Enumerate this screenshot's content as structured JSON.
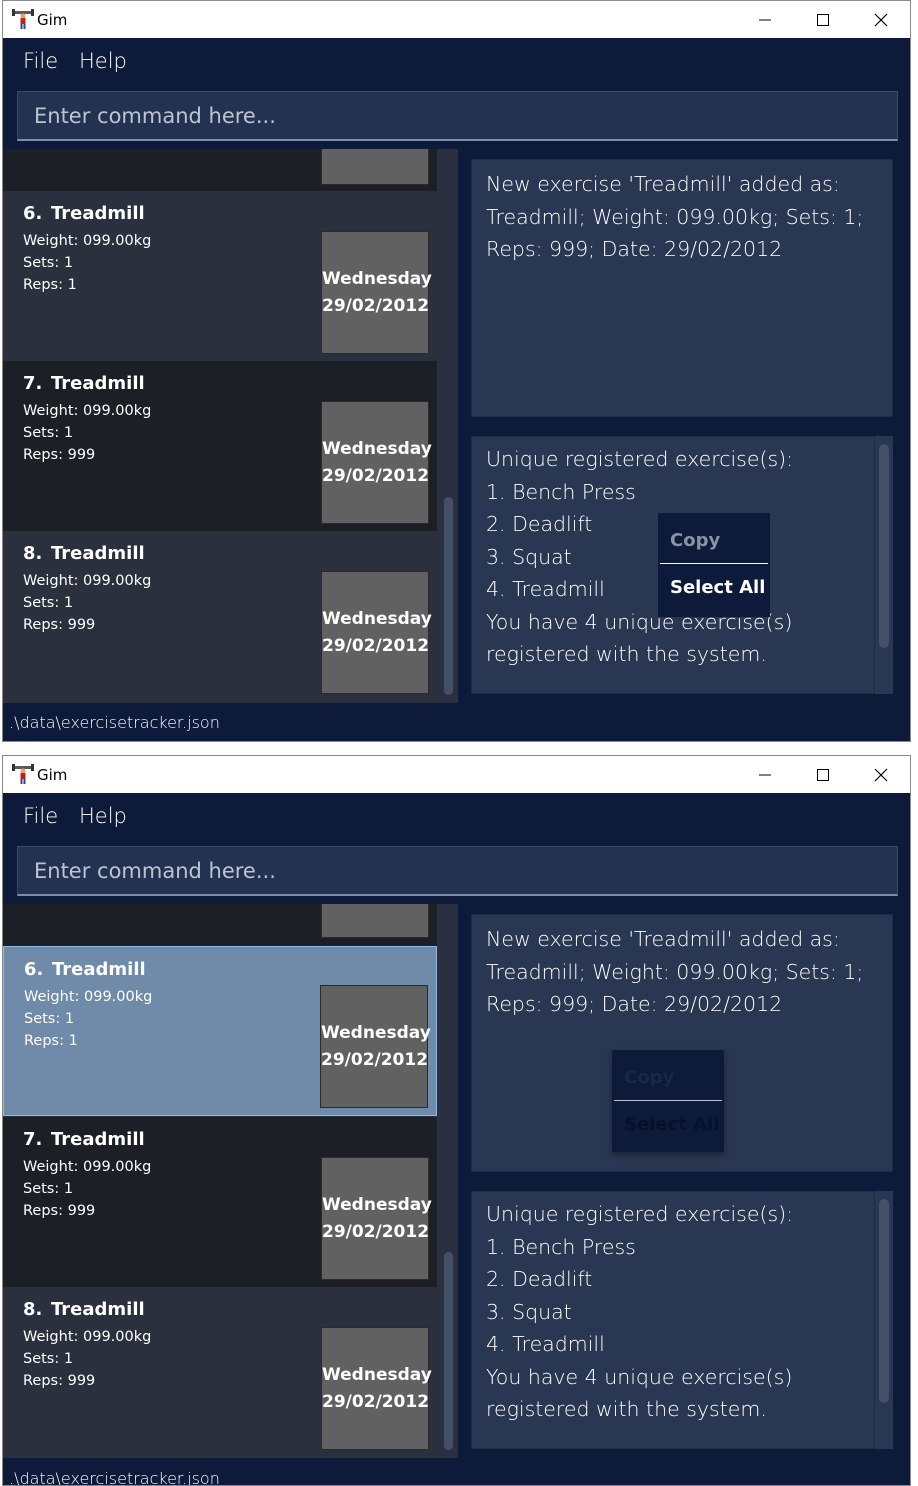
{
  "windows": [
    {
      "title": "Gim",
      "menu": {
        "file": "File",
        "help": "Help"
      },
      "command_placeholder": "Enter command here...",
      "cards": [
        {
          "index": "6.",
          "name": "Treadmill",
          "weight": "Weight: 099.00kg",
          "sets": "Sets: 1",
          "reps": "Reps: 1",
          "day": "Wednesday",
          "date": "29/02/2012"
        },
        {
          "index": "7.",
          "name": "Treadmill",
          "weight": "Weight: 099.00kg",
          "sets": "Sets: 1",
          "reps": "Reps: 999",
          "day": "Wednesday",
          "date": "29/02/2012"
        },
        {
          "index": "8.",
          "name": "Treadmill",
          "weight": "Weight: 099.00kg",
          "sets": "Sets: 1",
          "reps": "Reps: 999",
          "day": "Wednesday",
          "date": "29/02/2012"
        }
      ],
      "result_text": "New exercise 'Treadmill' added as: Treadmill; Weight: 099.00kg; Sets: 1; Reps: 999; Date: 29/02/2012",
      "summary_lines": [
        "Unique registered exercise(s):",
        "1. Bench Press",
        "2. Deadlift",
        "3. Squat",
        "4. Treadmill",
        "You have 4 unique exercise(s) registered with the system."
      ],
      "context_menu": {
        "copy": "Copy",
        "select_all": "Select All"
      },
      "status": ".\\data\\exercisetracker.json"
    },
    {
      "title": "Gim",
      "menu": {
        "file": "File",
        "help": "Help"
      },
      "command_placeholder": "Enter command here...",
      "cards": [
        {
          "index": "6.",
          "name": "Treadmill",
          "weight": "Weight: 099.00kg",
          "sets": "Sets: 1",
          "reps": "Reps: 1",
          "day": "Wednesday",
          "date": "29/02/2012",
          "selected": true
        },
        {
          "index": "7.",
          "name": "Treadmill",
          "weight": "Weight: 099.00kg",
          "sets": "Sets: 1",
          "reps": "Reps: 999",
          "day": "Wednesday",
          "date": "29/02/2012"
        },
        {
          "index": "8.",
          "name": "Treadmill",
          "weight": "Weight: 099.00kg",
          "sets": "Sets: 1",
          "reps": "Reps: 999",
          "day": "Wednesday",
          "date": "29/02/2012"
        }
      ],
      "result_text": "New exercise 'Treadmill' added as: Treadmill; Weight: 099.00kg; Sets: 1; Reps: 999; Date: 29/02/2012",
      "summary_lines": [
        "Unique registered exercise(s):",
        "1. Bench Press",
        "2. Deadlift",
        "3. Squat",
        "4. Treadmill",
        "You have 4 unique exercise(s) registered with the system."
      ],
      "context_menu": {
        "copy": "Copy",
        "select_all": "Select All"
      },
      "status": ".\\data\\exercisetracker.json"
    }
  ],
  "icons": {
    "app": "dumbbell-person-icon",
    "minimize": "minimize-icon",
    "maximize": "maximize-icon",
    "close": "close-icon"
  },
  "colors": {
    "background": "#0d1a3a",
    "panel": "#2a3752",
    "card_dark": "#1d1f27",
    "card_light": "#2b303e",
    "card_selected": "#6f8ba9",
    "date_box": "#616161"
  }
}
